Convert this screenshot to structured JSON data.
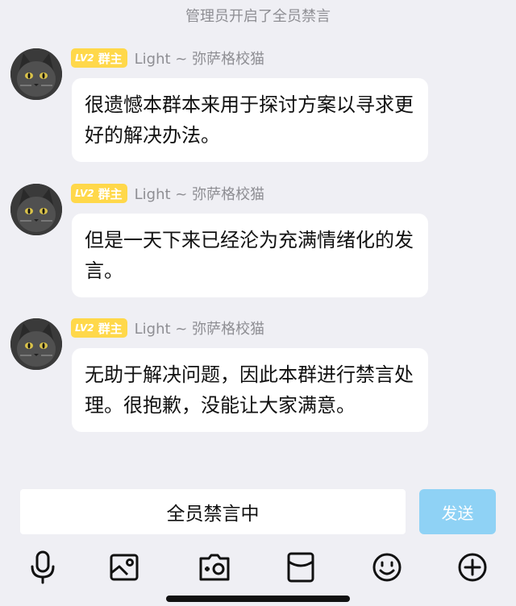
{
  "system_notice": "管理员开启了全员禁言",
  "messages": [
    {
      "level": "LV2",
      "role": "群主",
      "sender": "Light ~ 弥萨格校猫",
      "text": "很遗憾本群本来用于探讨方案以寻求更好的解决办法。"
    },
    {
      "level": "LV2",
      "role": "群主",
      "sender": "Light ~ 弥萨格校猫",
      "text": "但是一天下来已经沦为充满情绪化的发言。"
    },
    {
      "level": "LV2",
      "role": "群主",
      "sender": "Light ~ 弥萨格校猫",
      "text": "无助于解决问题，因此本群进行禁言处理。很抱歉，没能让大家满意。"
    }
  ],
  "input": {
    "muted_text": "全员禁言中",
    "send_label": "发送"
  },
  "toolbar": [
    "voice-icon",
    "image-icon",
    "camera-icon",
    "red-packet-icon",
    "emoji-icon",
    "add-icon"
  ],
  "colors": {
    "background": "#efeff4",
    "badge": "#ffd84a",
    "send_disabled": "#8fd2f5"
  }
}
